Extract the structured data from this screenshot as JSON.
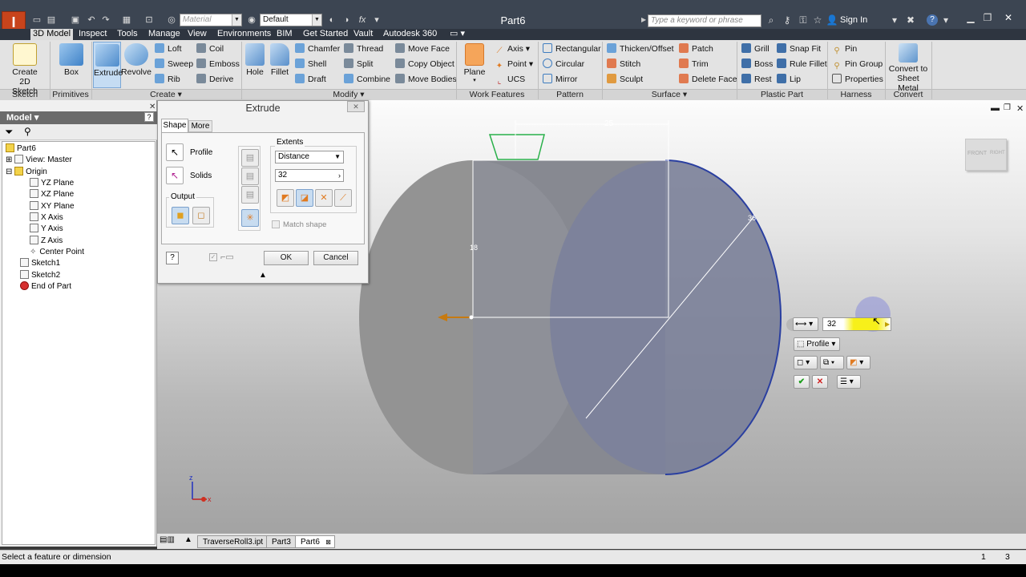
{
  "app": {
    "title": "Part6",
    "material_placeholder": "Material",
    "appearance": "Default",
    "search_placeholder": "Type a keyword or phrase",
    "signin": "Sign In"
  },
  "tabs": [
    "3D Model",
    "Inspect",
    "Tools",
    "Manage",
    "View",
    "Environments",
    "BIM",
    "Get Started",
    "Vault",
    "Autodesk 360"
  ],
  "ribbon": {
    "sketch": {
      "create_2d_sketch": "Create\n2D Sketch",
      "panel": "Sketch"
    },
    "primitives": {
      "box": "Box",
      "panel": "Primitives"
    },
    "create": {
      "extrude": "Extrude",
      "revolve": "Revolve",
      "loft": "Loft",
      "sweep": "Sweep",
      "rib": "Rib",
      "coil": "Coil",
      "emboss": "Emboss",
      "derive": "Derive",
      "panel": "Create"
    },
    "modify": {
      "hole": "Hole",
      "fillet": "Fillet",
      "chamfer": "Chamfer",
      "shell": "Shell",
      "draft": "Draft",
      "thread": "Thread",
      "split": "Split",
      "combine": "Combine",
      "move_face": "Move Face",
      "copy_object": "Copy Object",
      "move_bodies": "Move Bodies",
      "panel": "Modify"
    },
    "work_features": {
      "plane": "Plane",
      "axis": "Axis",
      "point": "Point",
      "ucs": "UCS",
      "panel": "Work Features"
    },
    "pattern": {
      "rectangular": "Rectangular",
      "circular": "Circular",
      "mirror": "Mirror",
      "panel": "Pattern"
    },
    "surface": {
      "thicken": "Thicken/Offset",
      "stitch": "Stitch",
      "sculpt": "Sculpt",
      "patch": "Patch",
      "trim": "Trim",
      "delete_face": "Delete Face",
      "panel": "Surface"
    },
    "plastic": {
      "grill": "Grill",
      "boss": "Boss",
      "rest": "Rest",
      "snap_fit": "Snap Fit",
      "rule_fillet": "Rule Fillet",
      "lip": "Lip",
      "panel": "Plastic Part"
    },
    "harness": {
      "pin": "Pin",
      "pin_group": "Pin Group",
      "properties": "Properties",
      "panel": "Harness"
    },
    "convert": {
      "label": "Convert to\nSheet Metal",
      "panel": "Convert"
    }
  },
  "browser": {
    "title": "Model",
    "tree": [
      "Part6",
      "View: Master",
      "Origin",
      "YZ Plane",
      "XZ Plane",
      "XY Plane",
      "X Axis",
      "Y Axis",
      "Z Axis",
      "Center Point",
      "Sketch1",
      "Sketch2",
      "End of Part"
    ]
  },
  "dialog": {
    "title": "Extrude",
    "tab_shape": "Shape",
    "tab_more": "More",
    "profile": "Profile",
    "solids": "Solids",
    "output": "Output",
    "extents": "Extents",
    "extent_type": "Distance",
    "distance": "32",
    "match_shape": "Match shape",
    "ok": "OK",
    "cancel": "Cancel"
  },
  "viewport": {
    "dim_width": "25",
    "dim_height": "18",
    "dim_diameter": "36",
    "viewcube_front": "FRONT",
    "viewcube_right": "RIGHT",
    "triad_x": "x",
    "triad_z": "z"
  },
  "mini_toolbar": {
    "distance": "32",
    "profile": "Profile"
  },
  "doc_tabs": [
    "TraverseRoll3.ipt",
    "Part3",
    "Part6"
  ],
  "status": {
    "message": "Select a feature or dimension",
    "count1": "1",
    "count2": "3"
  }
}
